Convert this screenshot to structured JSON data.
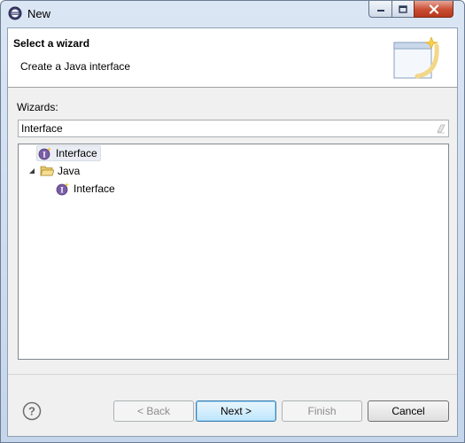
{
  "window": {
    "title": "New",
    "colors": {
      "close_button": "#c84d32",
      "titlebar": "#c5d5ea"
    }
  },
  "header": {
    "title": "Select a wizard",
    "description": "Create a Java interface",
    "banner_icon": "new-wizard-banner-icon"
  },
  "filter": {
    "label": "Wizards:",
    "value": "Interface"
  },
  "tree": {
    "items": [
      {
        "label": "Interface",
        "icon": "java-interface-icon",
        "selected": true
      },
      {
        "label": "Java",
        "icon": "folder-open-icon",
        "expanded": true
      },
      {
        "label": "Interface",
        "icon": "java-interface-icon"
      }
    ]
  },
  "buttons": {
    "back": "< Back",
    "next": "Next >",
    "finish": "Finish",
    "cancel": "Cancel"
  }
}
